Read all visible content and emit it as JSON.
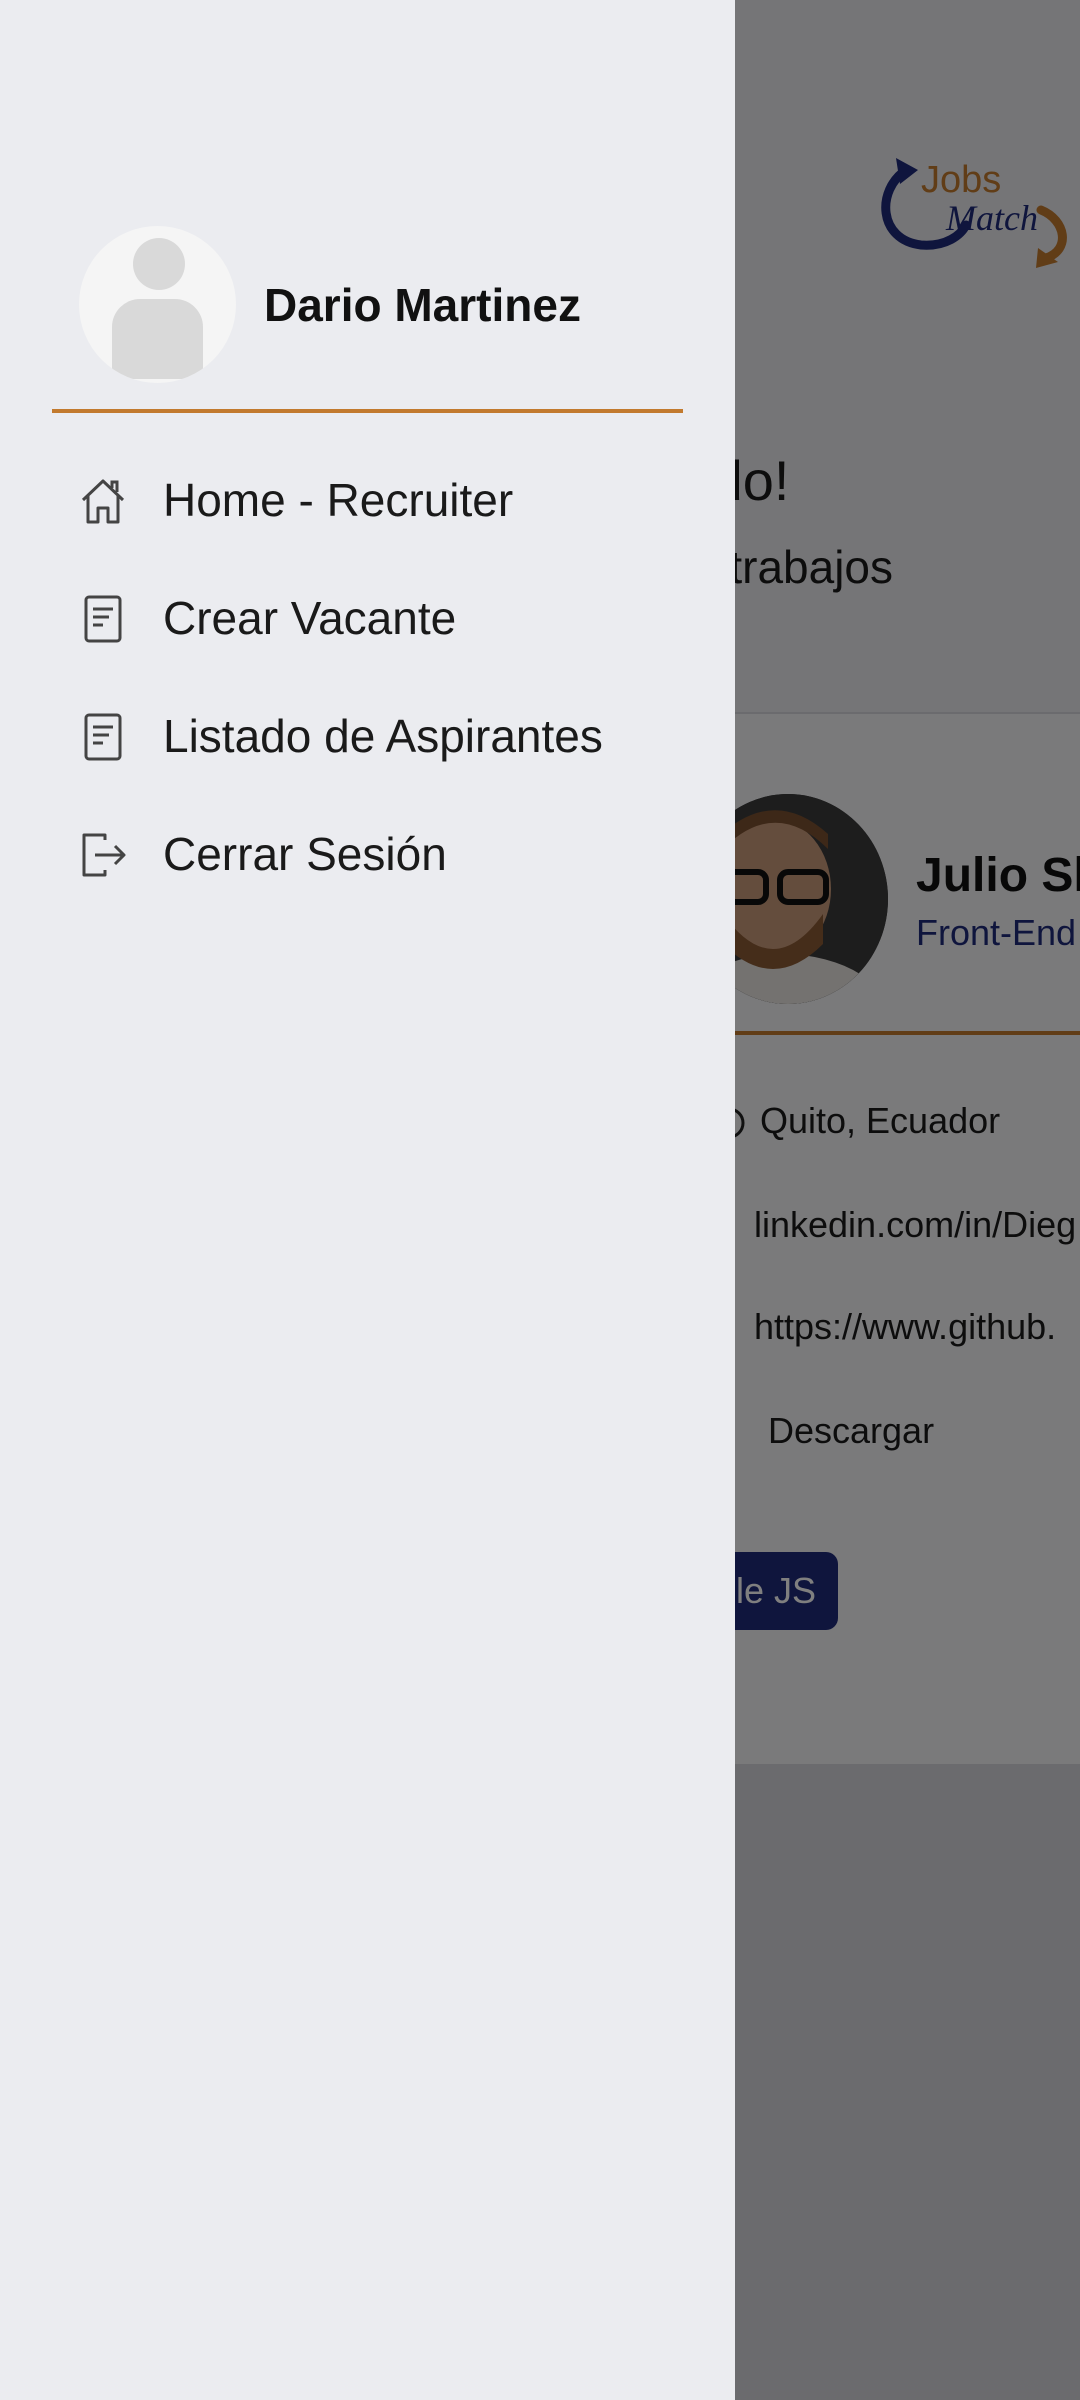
{
  "background": {
    "logo": {
      "line1": "Jobs",
      "line2": "Match"
    },
    "welcome": {
      "title_fragment": "nido!",
      "subtitle_fragment": "us trabajos"
    },
    "candidate": {
      "name_fragment": "Julio Sh",
      "role_fragment": "Front-End",
      "location": "Quito, Ecuador",
      "linkedin": "linkedin.com/in/Dieg",
      "github": "https://www.github.",
      "download_label": "Descargar",
      "skill_fragment": "le JS"
    }
  },
  "drawer": {
    "user_name": "Dario Martinez",
    "items": [
      {
        "label": "Home - Recruiter",
        "icon": "home-icon"
      },
      {
        "label": "Crear Vacante",
        "icon": "document-icon"
      },
      {
        "label": "Listado de Aspirantes",
        "icon": "document-icon"
      },
      {
        "label": "Cerrar Sesión",
        "icon": "logout-icon"
      }
    ]
  },
  "colors": {
    "accent_orange": "#c27a2e",
    "brand_navy": "#1f2a7a",
    "drawer_bg": "#ebecf0"
  }
}
